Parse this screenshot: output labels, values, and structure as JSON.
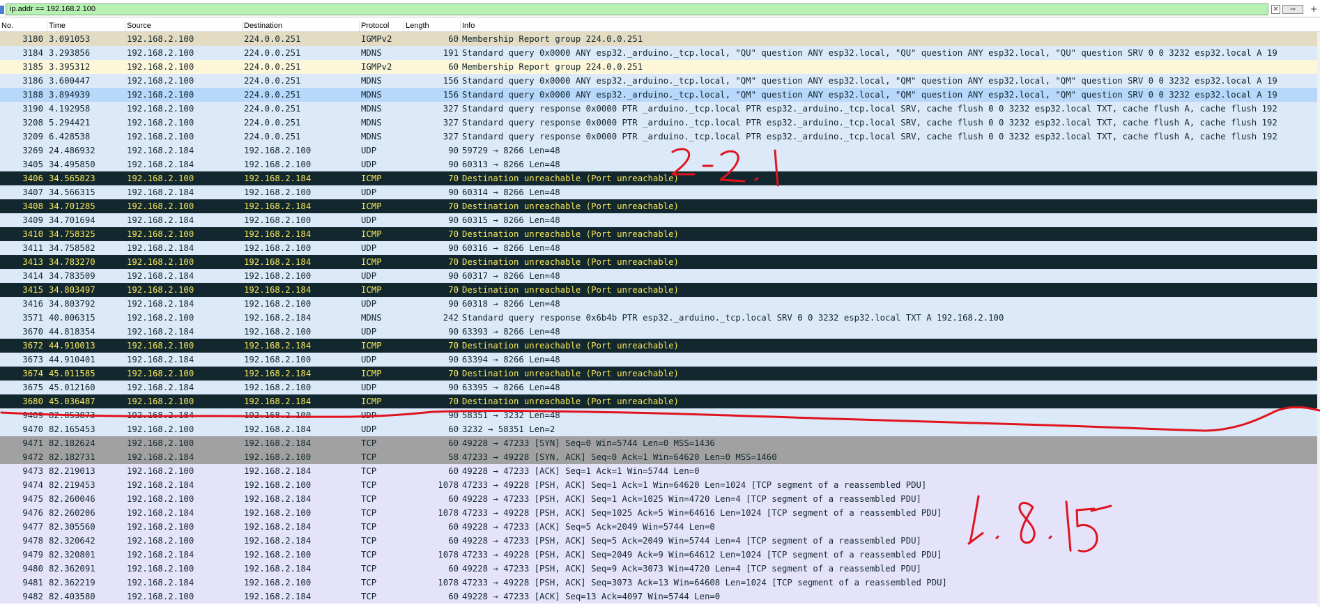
{
  "filter": {
    "value": "ip.addr == 192.168.2.100",
    "clear_label": "✕",
    "apply_label": "⇒",
    "add_label": "+"
  },
  "columns": {
    "no": "No.",
    "time": "Time",
    "source": "Source",
    "destination": "Destination",
    "protocol": "Protocol",
    "length": "Length",
    "info": "Info"
  },
  "packets": [
    {
      "no": "3180",
      "time": "3.091053",
      "src": "192.168.2.100",
      "dst": "224.0.0.251",
      "proto": "IGMPv2",
      "len": "60",
      "info": "Membership Report group 224.0.0.251",
      "style": "igmp"
    },
    {
      "no": "3184",
      "time": "3.293856",
      "src": "192.168.2.100",
      "dst": "224.0.0.251",
      "proto": "MDNS",
      "len": "191",
      "info": "Standard query 0x0000 ANY esp32._arduino._tcp.local, \"QU\" question ANY esp32.local, \"QU\" question ANY esp32.local, \"QU\" question SRV 0 0 3232 esp32.local A 19",
      "style": "mdns"
    },
    {
      "no": "3185",
      "time": "3.395312",
      "src": "192.168.2.100",
      "dst": "224.0.0.251",
      "proto": "IGMPv2",
      "len": "60",
      "info": "Membership Report group 224.0.0.251",
      "style": "sel"
    },
    {
      "no": "3186",
      "time": "3.600447",
      "src": "192.168.2.100",
      "dst": "224.0.0.251",
      "proto": "MDNS",
      "len": "156",
      "info": "Standard query 0x0000 ANY esp32._arduino._tcp.local, \"QM\" question ANY esp32.local, \"QM\" question ANY esp32.local, \"QM\" question SRV 0 0 3232 esp32.local A 19",
      "style": "mdns"
    },
    {
      "no": "3188",
      "time": "3.894939",
      "src": "192.168.2.100",
      "dst": "224.0.0.251",
      "proto": "MDNS",
      "len": "156",
      "info": "Standard query 0x0000 ANY esp32._arduino._tcp.local, \"QM\" question ANY esp32.local, \"QM\" question ANY esp32.local, \"QM\" question SRV 0 0 3232 esp32.local A 19",
      "style": "sel2"
    },
    {
      "no": "3190",
      "time": "4.192958",
      "src": "192.168.2.100",
      "dst": "224.0.0.251",
      "proto": "MDNS",
      "len": "327",
      "info": "Standard query response 0x0000 PTR _arduino._tcp.local PTR esp32._arduino._tcp.local SRV, cache flush 0 0 3232 esp32.local TXT, cache flush A, cache flush 192",
      "style": "mdns"
    },
    {
      "no": "3208",
      "time": "5.294421",
      "src": "192.168.2.100",
      "dst": "224.0.0.251",
      "proto": "MDNS",
      "len": "327",
      "info": "Standard query response 0x0000 PTR _arduino._tcp.local PTR esp32._arduino._tcp.local SRV, cache flush 0 0 3232 esp32.local TXT, cache flush A, cache flush 192",
      "style": "mdns"
    },
    {
      "no": "3209",
      "time": "6.428538",
      "src": "192.168.2.100",
      "dst": "224.0.0.251",
      "proto": "MDNS",
      "len": "327",
      "info": "Standard query response 0x0000 PTR _arduino._tcp.local PTR esp32._arduino._tcp.local SRV, cache flush 0 0 3232 esp32.local TXT, cache flush A, cache flush 192",
      "style": "mdns"
    },
    {
      "no": "3269",
      "time": "24.486932",
      "src": "192.168.2.184",
      "dst": "192.168.2.100",
      "proto": "UDP",
      "len": "90",
      "info": "59729 → 8266 Len=48",
      "style": "udp"
    },
    {
      "no": "3405",
      "time": "34.495850",
      "src": "192.168.2.184",
      "dst": "192.168.2.100",
      "proto": "UDP",
      "len": "90",
      "info": "60313 → 8266 Len=48",
      "style": "udp"
    },
    {
      "no": "3406",
      "time": "34.565823",
      "src": "192.168.2.100",
      "dst": "192.168.2.184",
      "proto": "ICMP",
      "len": "70",
      "info": "Destination unreachable (Port unreachable)",
      "style": "icmp"
    },
    {
      "no": "3407",
      "time": "34.566315",
      "src": "192.168.2.184",
      "dst": "192.168.2.100",
      "proto": "UDP",
      "len": "90",
      "info": "60314 → 8266 Len=48",
      "style": "udp"
    },
    {
      "no": "3408",
      "time": "34.701285",
      "src": "192.168.2.100",
      "dst": "192.168.2.184",
      "proto": "ICMP",
      "len": "70",
      "info": "Destination unreachable (Port unreachable)",
      "style": "icmp"
    },
    {
      "no": "3409",
      "time": "34.701694",
      "src": "192.168.2.184",
      "dst": "192.168.2.100",
      "proto": "UDP",
      "len": "90",
      "info": "60315 → 8266 Len=48",
      "style": "udp"
    },
    {
      "no": "3410",
      "time": "34.758325",
      "src": "192.168.2.100",
      "dst": "192.168.2.184",
      "proto": "ICMP",
      "len": "70",
      "info": "Destination unreachable (Port unreachable)",
      "style": "icmp"
    },
    {
      "no": "3411",
      "time": "34.758582",
      "src": "192.168.2.184",
      "dst": "192.168.2.100",
      "proto": "UDP",
      "len": "90",
      "info": "60316 → 8266 Len=48",
      "style": "udp"
    },
    {
      "no": "3413",
      "time": "34.783270",
      "src": "192.168.2.100",
      "dst": "192.168.2.184",
      "proto": "ICMP",
      "len": "70",
      "info": "Destination unreachable (Port unreachable)",
      "style": "icmp"
    },
    {
      "no": "3414",
      "time": "34.783509",
      "src": "192.168.2.184",
      "dst": "192.168.2.100",
      "proto": "UDP",
      "len": "90",
      "info": "60317 → 8266 Len=48",
      "style": "udp"
    },
    {
      "no": "3415",
      "time": "34.803497",
      "src": "192.168.2.100",
      "dst": "192.168.2.184",
      "proto": "ICMP",
      "len": "70",
      "info": "Destination unreachable (Port unreachable)",
      "style": "icmp"
    },
    {
      "no": "3416",
      "time": "34.803792",
      "src": "192.168.2.184",
      "dst": "192.168.2.100",
      "proto": "UDP",
      "len": "90",
      "info": "60318 → 8266 Len=48",
      "style": "udp"
    },
    {
      "no": "3571",
      "time": "40.006315",
      "src": "192.168.2.100",
      "dst": "192.168.2.184",
      "proto": "MDNS",
      "len": "242",
      "info": "Standard query response 0x6b4b PTR esp32._arduino._tcp.local SRV 0 0 3232 esp32.local TXT A 192.168.2.100",
      "style": "mdns"
    },
    {
      "no": "3670",
      "time": "44.818354",
      "src": "192.168.2.184",
      "dst": "192.168.2.100",
      "proto": "UDP",
      "len": "90",
      "info": "63393 → 8266 Len=48",
      "style": "udp"
    },
    {
      "no": "3672",
      "time": "44.910013",
      "src": "192.168.2.100",
      "dst": "192.168.2.184",
      "proto": "ICMP",
      "len": "70",
      "info": "Destination unreachable (Port unreachable)",
      "style": "icmp"
    },
    {
      "no": "3673",
      "time": "44.910401",
      "src": "192.168.2.184",
      "dst": "192.168.2.100",
      "proto": "UDP",
      "len": "90",
      "info": "63394 → 8266 Len=48",
      "style": "udp"
    },
    {
      "no": "3674",
      "time": "45.011585",
      "src": "192.168.2.100",
      "dst": "192.168.2.184",
      "proto": "ICMP",
      "len": "70",
      "info": "Destination unreachable (Port unreachable)",
      "style": "icmp"
    },
    {
      "no": "3675",
      "time": "45.012160",
      "src": "192.168.2.184",
      "dst": "192.168.2.100",
      "proto": "UDP",
      "len": "90",
      "info": "63395 → 8266 Len=48",
      "style": "udp"
    },
    {
      "no": "3680",
      "time": "45.036487",
      "src": "192.168.2.100",
      "dst": "192.168.2.184",
      "proto": "ICMP",
      "len": "70",
      "info": "Destination unreachable (Port unreachable)",
      "style": "icmp"
    },
    {
      "no": "9469",
      "time": "82.053873",
      "src": "192.168.2.184",
      "dst": "192.168.2.100",
      "proto": "UDP",
      "len": "90",
      "info": "58351 → 3232 Len=48",
      "style": "udp"
    },
    {
      "no": "9470",
      "time": "82.165453",
      "src": "192.168.2.100",
      "dst": "192.168.2.184",
      "proto": "UDP",
      "len": "60",
      "info": "3232 → 58351 Len=2",
      "style": "udp"
    },
    {
      "no": "9471",
      "time": "82.182624",
      "src": "192.168.2.100",
      "dst": "192.168.2.184",
      "proto": "TCP",
      "len": "60",
      "info": "49228 → 47233 [SYN] Seq=0 Win=5744 Len=0 MSS=1436",
      "style": "syn"
    },
    {
      "no": "9472",
      "time": "82.182731",
      "src": "192.168.2.184",
      "dst": "192.168.2.100",
      "proto": "TCP",
      "len": "58",
      "info": "47233 → 49228 [SYN, ACK] Seq=0 Ack=1 Win=64620 Len=0 MSS=1460",
      "style": "syn"
    },
    {
      "no": "9473",
      "time": "82.219013",
      "src": "192.168.2.100",
      "dst": "192.168.2.184",
      "proto": "TCP",
      "len": "60",
      "info": "49228 → 47233 [ACK] Seq=1 Ack=1 Win=5744 Len=0",
      "style": "tcp"
    },
    {
      "no": "9474",
      "time": "82.219453",
      "src": "192.168.2.184",
      "dst": "192.168.2.100",
      "proto": "TCP",
      "len": "1078",
      "info": "47233 → 49228 [PSH, ACK] Seq=1 Ack=1 Win=64620 Len=1024 [TCP segment of a reassembled PDU]",
      "style": "tcp"
    },
    {
      "no": "9475",
      "time": "82.260046",
      "src": "192.168.2.100",
      "dst": "192.168.2.184",
      "proto": "TCP",
      "len": "60",
      "info": "49228 → 47233 [PSH, ACK] Seq=1 Ack=1025 Win=4720 Len=4 [TCP segment of a reassembled PDU]",
      "style": "tcp"
    },
    {
      "no": "9476",
      "time": "82.260206",
      "src": "192.168.2.184",
      "dst": "192.168.2.100",
      "proto": "TCP",
      "len": "1078",
      "info": "47233 → 49228 [PSH, ACK] Seq=1025 Ack=5 Win=64616 Len=1024 [TCP segment of a reassembled PDU]",
      "style": "tcp"
    },
    {
      "no": "9477",
      "time": "82.305560",
      "src": "192.168.2.100",
      "dst": "192.168.2.184",
      "proto": "TCP",
      "len": "60",
      "info": "49228 → 47233 [ACK] Seq=5 Ack=2049 Win=5744 Len=0",
      "style": "tcp"
    },
    {
      "no": "9478",
      "time": "82.320642",
      "src": "192.168.2.100",
      "dst": "192.168.2.184",
      "proto": "TCP",
      "len": "60",
      "info": "49228 → 47233 [PSH, ACK] Seq=5 Ack=2049 Win=5744 Len=4 [TCP segment of a reassembled PDU]",
      "style": "tcp"
    },
    {
      "no": "9479",
      "time": "82.320801",
      "src": "192.168.2.184",
      "dst": "192.168.2.100",
      "proto": "TCP",
      "len": "1078",
      "info": "47233 → 49228 [PSH, ACK] Seq=2049 Ack=9 Win=64612 Len=1024 [TCP segment of a reassembled PDU]",
      "style": "tcp"
    },
    {
      "no": "9480",
      "time": "82.362091",
      "src": "192.168.2.100",
      "dst": "192.168.2.184",
      "proto": "TCP",
      "len": "60",
      "info": "49228 → 47233 [PSH, ACK] Seq=9 Ack=3073 Win=4720 Len=4 [TCP segment of a reassembled PDU]",
      "style": "tcp"
    },
    {
      "no": "9481",
      "time": "82.362219",
      "src": "192.168.2.184",
      "dst": "192.168.2.100",
      "proto": "TCP",
      "len": "1078",
      "info": "47233 → 49228 [PSH, ACK] Seq=3073 Ack=13 Win=64608 Len=1024 [TCP segment of a reassembled PDU]",
      "style": "tcp"
    },
    {
      "no": "9482",
      "time": "82.403580",
      "src": "192.168.2.100",
      "dst": "192.168.2.184",
      "proto": "TCP",
      "len": "60",
      "info": "49228 → 47233 [ACK] Seq=13 Ack=4097 Win=5744 Len=0",
      "style": "tcp"
    }
  ],
  "annotations": {
    "color": "#e0141e",
    "version_old": "2.2.1",
    "version_new": "1.8.15"
  }
}
